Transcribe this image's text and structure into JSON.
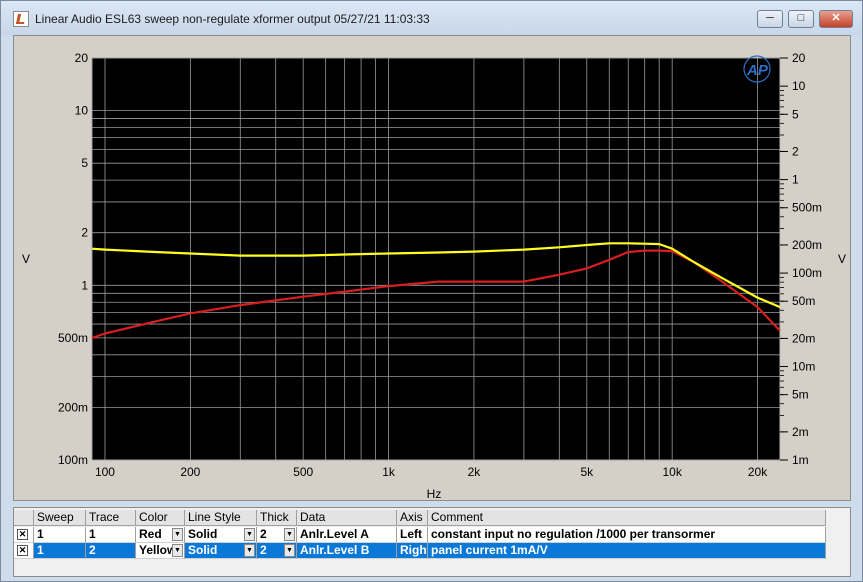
{
  "window": {
    "title": "Linear Audio  ESL63 sweep non-regulate xformer output  05/27/21 11:03:33",
    "minimize_glyph": "─",
    "maximize_glyph": "□",
    "close_glyph": "✕"
  },
  "plot": {
    "logo_text": "AP",
    "xlabel": "Hz",
    "ylabel_left": "V",
    "ylabel_right": "V",
    "background": "#000000",
    "grid_color": "#9a9a9a",
    "x_ticks": [
      "100",
      "200",
      "500",
      "1k",
      "2k",
      "5k",
      "10k",
      "20k"
    ],
    "y_left_ticks": [
      "20",
      "10",
      "5",
      "2",
      "1",
      "500m",
      "200m",
      "100m"
    ],
    "y_right_ticks": [
      "20",
      "10",
      "5",
      "2",
      "1",
      "500m",
      "200m",
      "100m",
      "50m",
      "20m",
      "10m",
      "5m",
      "2m",
      "1m"
    ]
  },
  "chart_data": {
    "type": "line",
    "x_scale": "log",
    "xlabel": "Hz",
    "ylabel_left": "V",
    "ylabel_right": "V",
    "xlim": [
      90,
      24000
    ],
    "ylim_left": [
      0.1,
      20
    ],
    "ylim_right": [
      0.001,
      20
    ],
    "y_left_scale": "log",
    "y_right_scale": "log",
    "grid": true,
    "series": [
      {
        "color": "#d81e1e",
        "axis": "left",
        "x": [
          90,
          100,
          150,
          200,
          300,
          500,
          700,
          1000,
          1500,
          2000,
          3000,
          4000,
          5000,
          6000,
          7000,
          8000,
          9000,
          10000,
          12000,
          15000,
          20000,
          24000
        ],
        "y": [
          0.5,
          0.53,
          0.62,
          0.69,
          0.77,
          0.86,
          0.92,
          0.99,
          1.05,
          1.05,
          1.05,
          1.15,
          1.25,
          1.4,
          1.55,
          1.58,
          1.58,
          1.57,
          1.35,
          1.05,
          0.75,
          0.55
        ]
      },
      {
        "color": "#ffff20",
        "axis": "left",
        "x": [
          90,
          100,
          150,
          200,
          300,
          500,
          700,
          1000,
          1500,
          2000,
          3000,
          4000,
          5000,
          6000,
          7000,
          8000,
          9000,
          10000,
          12000,
          15000,
          20000,
          24000
        ],
        "y": [
          1.62,
          1.6,
          1.55,
          1.52,
          1.48,
          1.48,
          1.5,
          1.52,
          1.54,
          1.56,
          1.6,
          1.65,
          1.7,
          1.74,
          1.74,
          1.73,
          1.72,
          1.62,
          1.35,
          1.1,
          0.85,
          0.75
        ]
      }
    ]
  },
  "legend": {
    "columns": [
      "Sweep",
      "Trace",
      "Color",
      "Line Style",
      "Thick",
      "Data",
      "Axis",
      "Comment"
    ],
    "rows": [
      {
        "checked": "✕",
        "sweep": "1",
        "trace": "1",
        "color": "Red",
        "line_style": "Solid",
        "thick": "2",
        "data": "Anlr.Level A",
        "axis": "Left",
        "comment": "constant input no regulation /1000 per transormer"
      },
      {
        "checked": "✕",
        "sweep": "1",
        "trace": "2",
        "color": "Yellow",
        "line_style": "Solid",
        "thick": "2",
        "data": "Anlr.Level B",
        "axis": "Right",
        "comment": "panel current 1mA/V"
      }
    ],
    "dropdown_glyph": "▼"
  }
}
